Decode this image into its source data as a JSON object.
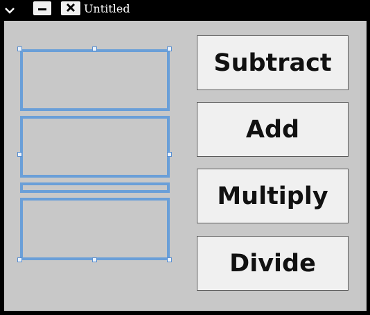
{
  "window": {
    "title": "Untitled"
  },
  "title_bar": {
    "menu_icon": "chevron-down-icon",
    "minimize_icon": "minimize-icon",
    "close_icon": "close-icon"
  },
  "buttons": [
    {
      "label": "Subtract"
    },
    {
      "label": "Add"
    },
    {
      "label": "Multiply"
    },
    {
      "label": "Divide"
    }
  ],
  "colors": {
    "selection_border": "#6a9fd8",
    "client_background": "#c8c8c8",
    "button_background": "#f0f0f0"
  }
}
